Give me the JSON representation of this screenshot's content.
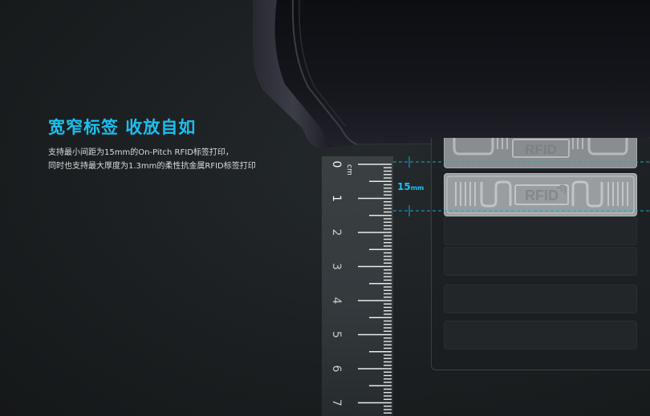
{
  "headline": "宽窄标签 收放自如",
  "description": {
    "line1": "支持最小间距为15mm的On-Pitch RFID标签打印，",
    "line2": "同时也支持最大厚度为1.3mm的柔性抗金属RFID标签打印"
  },
  "pitch": {
    "value": "15",
    "unit": "mm"
  },
  "ruler": {
    "numbers": [
      "0",
      "1",
      "2",
      "3",
      "4",
      "5",
      "6",
      "7"
    ],
    "unit": "cm"
  },
  "label_text": "RFID",
  "colors": {
    "accent": "#19c0ee",
    "background": "#1b1f21",
    "label": "#9a9d9f"
  }
}
